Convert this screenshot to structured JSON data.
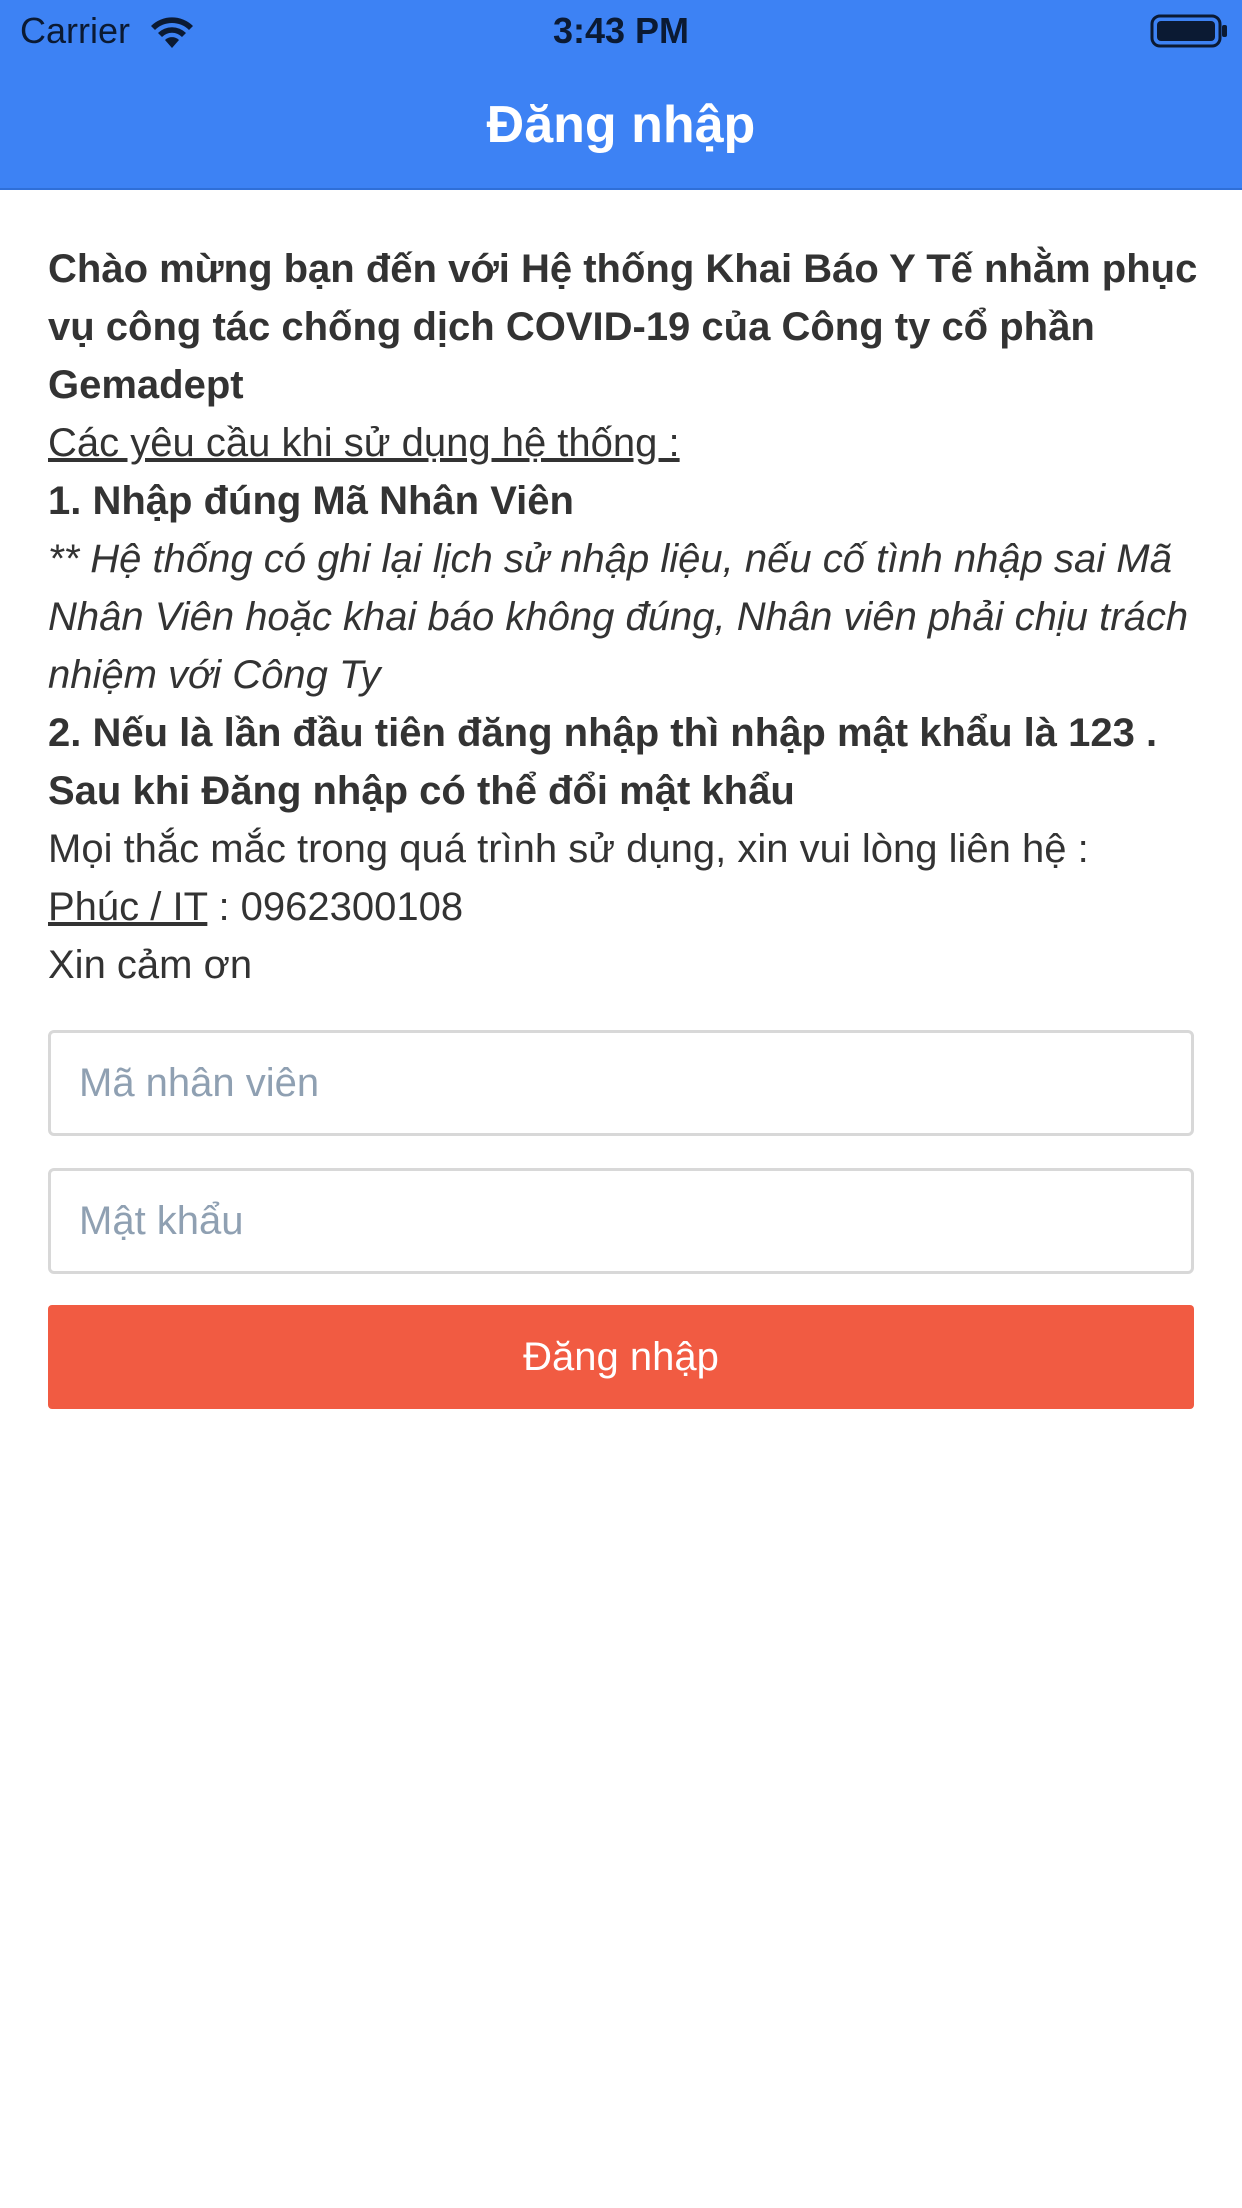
{
  "status_bar": {
    "carrier": "Carrier",
    "time": "3:43 PM",
    "wifi_icon": "wifi-icon",
    "battery_icon": "battery-icon"
  },
  "header": {
    "title": "Đăng nhập",
    "color": "#3d82f4"
  },
  "intro": {
    "welcome": "Chào mừng bạn đến với Hệ thống Khai Báo Y Tế nhằm phục vụ công tác chống dịch COVID-19 của Công ty cổ phần Gemadept",
    "requirements_heading": "Các yêu cầu khi sử dụng hệ thống :",
    "rule1": "1. Nhập đúng Mã Nhân Viên",
    "rule1_note": "** Hệ thống có ghi lại lịch sử nhập liệu, nếu cố tình nhập sai Mã Nhân Viên hoặc khai báo không đúng, Nhân viên phải chịu trách nhiệm với Công Ty",
    "rule2": "2. Nếu là lần đầu tiên đăng nhập thì nhập mật khẩu là 123 . Sau khi Đăng nhập có thể đổi mật khẩu",
    "contact_text": "Mọi thắc mắc trong quá trình sử dụng, xin vui lòng liên hệ :",
    "contact_name": "Phúc / IT",
    "contact_phone": " : 0962300108",
    "thanks": "Xin cảm ơn"
  },
  "form": {
    "employee_id": {
      "value": "",
      "placeholder": "Mã nhân viên"
    },
    "password": {
      "value": "",
      "placeholder": "Mật khẩu"
    },
    "submit_label": "Đăng nhập",
    "submit_color": "#f15b42"
  }
}
